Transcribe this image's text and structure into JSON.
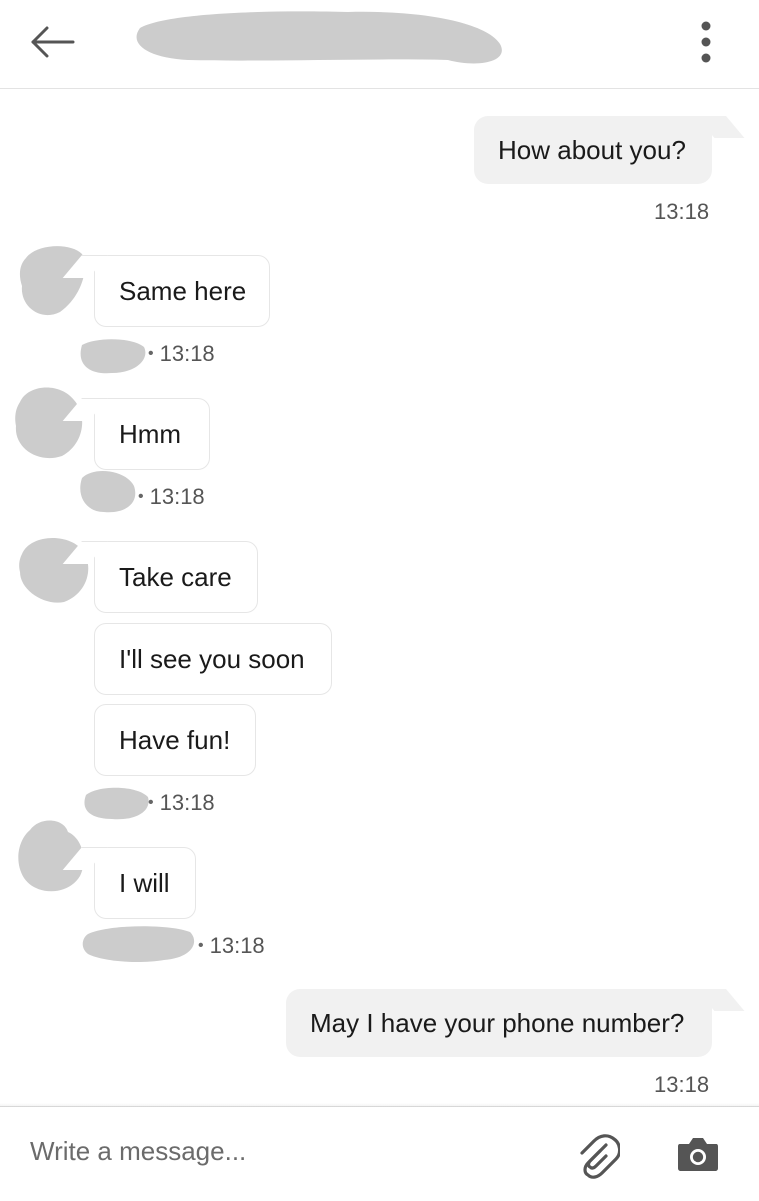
{
  "header": {
    "back_icon": "arrow-left-icon",
    "menu_icon": "more-vertical-icon"
  },
  "messages": [
    {
      "direction": "outgoing",
      "text": "How about you?",
      "time": "13:18"
    },
    {
      "direction": "incoming",
      "text": "Same here",
      "time": "13:18"
    },
    {
      "direction": "incoming",
      "text": "Hmm",
      "time": "13:18"
    },
    {
      "direction": "incoming",
      "text": "Take care",
      "time": ""
    },
    {
      "direction": "incoming",
      "text": "I'll see you soon",
      "time": ""
    },
    {
      "direction": "incoming",
      "text": "Have fun!",
      "time": "13:18"
    },
    {
      "direction": "incoming",
      "text": "I will",
      "time": "13:18"
    },
    {
      "direction": "outgoing",
      "text": "May I have your phone number?",
      "time": "13:18"
    }
  ],
  "composer": {
    "placeholder": "Write a message...",
    "attach_icon": "paperclip-icon",
    "camera_icon": "camera-icon"
  },
  "colors": {
    "outgoing_bubble": "#f1f1f1",
    "incoming_border": "#e6e6e6",
    "redaction": "#cccccc",
    "icon": "#555555"
  }
}
